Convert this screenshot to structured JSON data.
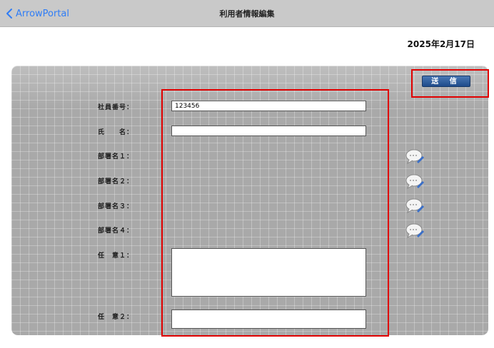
{
  "navbar": {
    "back_label": "ArrowPortal",
    "title": "利用者情報編集"
  },
  "date": "2025年2月17日",
  "form": {
    "send_label": "送 信",
    "employee_no": {
      "label": "社員番号：",
      "value": "123456"
    },
    "name": {
      "label": "氏　　名：",
      "value": ""
    },
    "dept1": {
      "label": "部署名１："
    },
    "dept2": {
      "label": "部署名２："
    },
    "dept3": {
      "label": "部署名３："
    },
    "dept4": {
      "label": "部署名４："
    },
    "optional1": {
      "label": "任　意１：",
      "value": ""
    },
    "optional2": {
      "label": "任　意２：",
      "value": ""
    }
  },
  "colors": {
    "highlight": "#e00000",
    "link": "#2f7df6"
  },
  "icons": {
    "back": "chevron-left-icon",
    "dept_picker": "chat-bubble-edit-icon"
  }
}
